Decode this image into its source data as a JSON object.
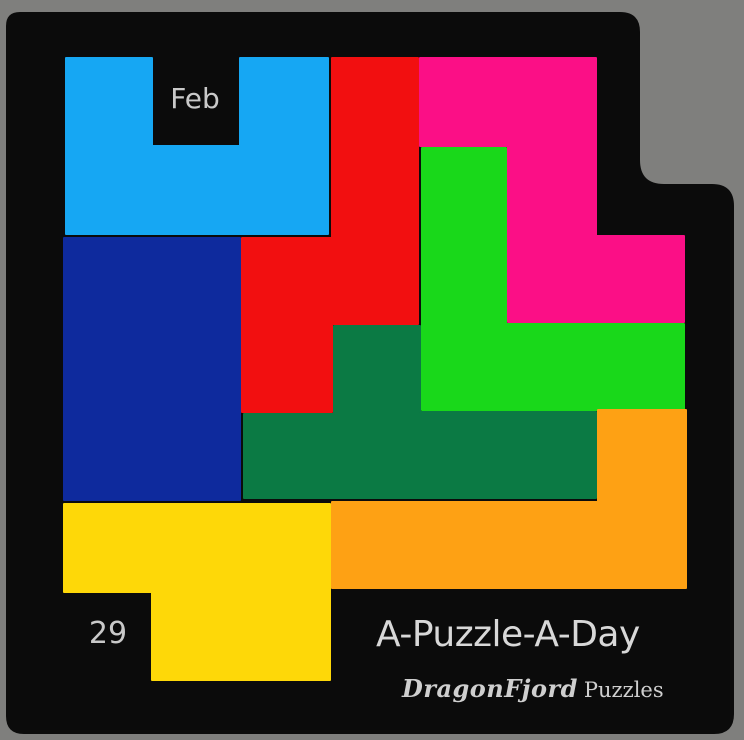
{
  "scene": {
    "board_color": "#0b0b0b",
    "background_color": "#7f7f7d"
  },
  "pieces": [
    {
      "name": "light-blue-piece",
      "color": "#16a7f3"
    },
    {
      "name": "red-piece",
      "color": "#f20f10"
    },
    {
      "name": "pink-piece",
      "color": "#fb0f86"
    },
    {
      "name": "bright-green-piece",
      "color": "#19d81a"
    },
    {
      "name": "navy-piece",
      "color": "#0e2a9d"
    },
    {
      "name": "dark-green-piece",
      "color": "#0b7a44"
    },
    {
      "name": "yellow-piece",
      "color": "#fed808"
    },
    {
      "name": "orange-piece",
      "color": "#fea114"
    }
  ],
  "visible_cells": {
    "month": "Feb",
    "day": "29"
  },
  "branding": {
    "title": "A-Puzzle-A-Day",
    "maker_logo": "DragonFjord",
    "maker_sub": "Puzzles"
  }
}
